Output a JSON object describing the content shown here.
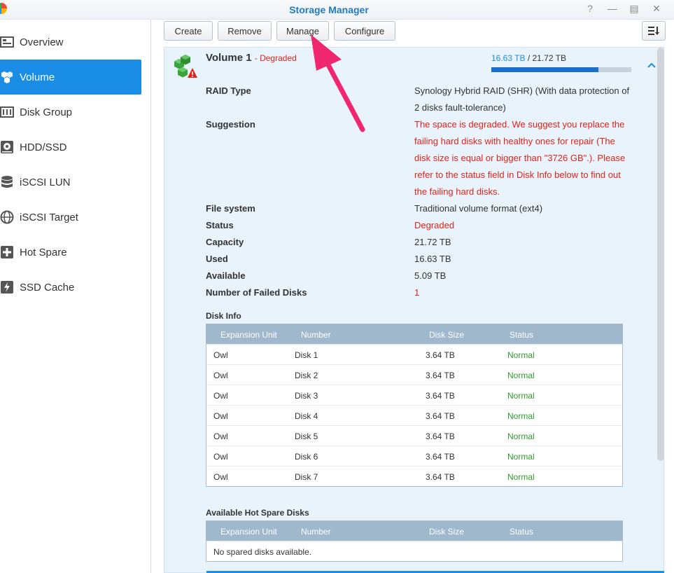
{
  "window": {
    "title": "Storage Manager"
  },
  "sidebar": {
    "items": [
      {
        "label": "Overview",
        "icon": "overview-icon"
      },
      {
        "label": "Volume",
        "icon": "volume-icon"
      },
      {
        "label": "Disk Group",
        "icon": "disk-group-icon"
      },
      {
        "label": "HDD/SSD",
        "icon": "hdd-icon"
      },
      {
        "label": "iSCSI LUN",
        "icon": "iscsi-lun-icon"
      },
      {
        "label": "iSCSI Target",
        "icon": "iscsi-target-icon"
      },
      {
        "label": "Hot Spare",
        "icon": "hot-spare-icon"
      },
      {
        "label": "SSD Cache",
        "icon": "ssd-cache-icon"
      }
    ],
    "active": "Volume"
  },
  "toolbar": {
    "create": "Create",
    "remove": "Remove",
    "manage": "Manage",
    "configure": "Configure"
  },
  "volume": {
    "name": "Volume 1",
    "state": "- Degraded",
    "used": "16.63 TB",
    "separator": " / ",
    "total": "21.72 TB",
    "usage_fraction": 0.766,
    "details": {
      "raid_type_label": "RAID Type",
      "raid_type_value": "Synology Hybrid RAID (SHR) (With data protection of 2 disks fault-tolerance)",
      "suggestion_label": "Suggestion",
      "suggestion_value": "The space is degraded. We suggest you replace the failing hard disks with healthy ones for repair (The disk size is equal or bigger than \"3726 GB\".). Please refer to the status field in Disk Info below to find out the failing hard disks.",
      "file_system_label": "File system",
      "file_system_value": "Traditional volume format (ext4)",
      "status_label": "Status",
      "status_value": "Degraded",
      "capacity_label": "Capacity",
      "capacity_value": "21.72 TB",
      "used_label": "Used",
      "used_value": "16.63 TB",
      "available_label": "Available",
      "available_value": "5.09 TB",
      "failed_label": "Number of Failed Disks",
      "failed_value": "1"
    }
  },
  "disk_info": {
    "title": "Disk Info",
    "columns": [
      "Expansion Unit",
      "Number",
      "Disk Size",
      "Status"
    ],
    "rows": [
      [
        "Owl",
        "Disk 1",
        "3.64 TB",
        "Normal"
      ],
      [
        "Owl",
        "Disk 2",
        "3.64 TB",
        "Normal"
      ],
      [
        "Owl",
        "Disk 3",
        "3.64 TB",
        "Normal"
      ],
      [
        "Owl",
        "Disk 4",
        "3.64 TB",
        "Normal"
      ],
      [
        "Owl",
        "Disk 5",
        "3.64 TB",
        "Normal"
      ],
      [
        "Owl",
        "Disk 6",
        "3.64 TB",
        "Normal"
      ],
      [
        "Owl",
        "Disk 7",
        "3.64 TB",
        "Normal"
      ]
    ]
  },
  "hot_spare": {
    "title": "Available Hot Spare Disks",
    "columns": [
      "Expansion Unit",
      "Number",
      "Disk Size",
      "Status"
    ],
    "empty_text": "No spared disks available."
  },
  "colors": {
    "accent": "#1a8ee6",
    "error": "#e2231a",
    "ok": "#2e9c2e",
    "annotation_arrow": "#f0266f"
  }
}
